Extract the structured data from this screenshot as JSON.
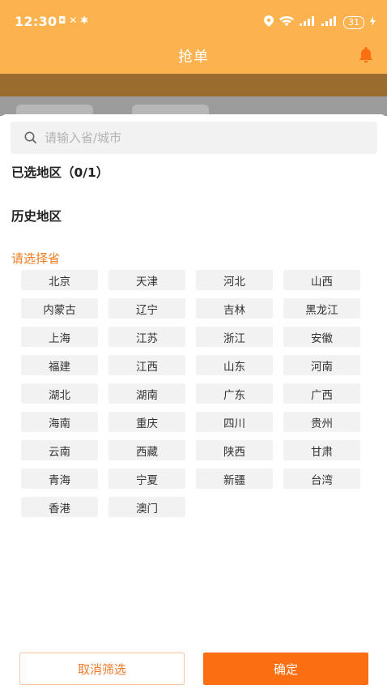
{
  "status_bar": {
    "time": "12:30",
    "left_icons": "◘ ✕ ✱",
    "battery": "31"
  },
  "header": {
    "title": "抢单"
  },
  "search": {
    "placeholder": "请输入省/城市"
  },
  "selected_label": "已选地区（0/1）",
  "history_label": "历史地区",
  "choose_label": "请选择省",
  "provinces": [
    "北京",
    "天津",
    "河北",
    "山西",
    "内蒙古",
    "辽宁",
    "吉林",
    "黑龙江",
    "上海",
    "江苏",
    "浙江",
    "安徽",
    "福建",
    "江西",
    "山东",
    "河南",
    "湖北",
    "湖南",
    "广东",
    "广西",
    "海南",
    "重庆",
    "四川",
    "贵州",
    "云南",
    "西藏",
    "陕西",
    "甘肃",
    "青海",
    "宁夏",
    "新疆",
    "台湾",
    "香港",
    "澳门"
  ],
  "buttons": {
    "cancel": "取消筛选",
    "confirm": "确定"
  },
  "colors": {
    "header_bg": "#FBB24F",
    "accent": "#FB6E12",
    "choose_label": "#F27C22"
  }
}
